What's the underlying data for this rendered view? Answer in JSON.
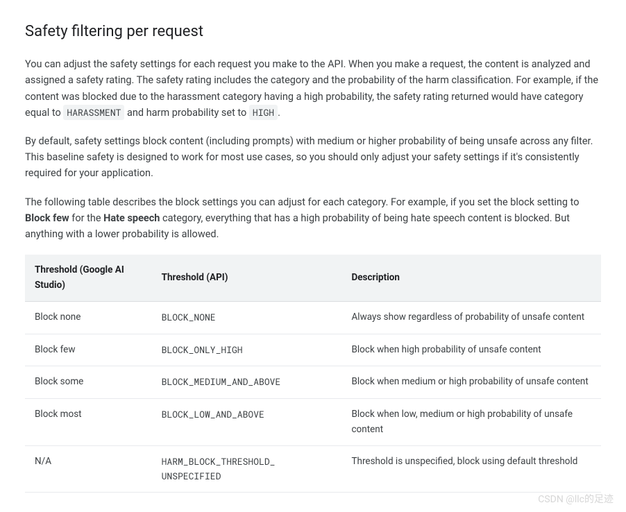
{
  "heading": "Safety filtering per request",
  "para1_pre": "You can adjust the safety settings for each request you make to the API. When you make a request, the content is analyzed and assigned a safety rating. The safety rating includes the category and the probability of the harm classification. For example, if the content was blocked due to the harassment category having a high probability, the safety rating returned would have category equal to ",
  "para1_code1": "HARASSMENT",
  "para1_mid": " and harm probability set to ",
  "para1_code2": "HIGH",
  "para1_post": ".",
  "para2": "By default, safety settings block content (including prompts) with medium or higher probability of being unsafe across any filter. This baseline safety is designed to work for most use cases, so you should only adjust your safety settings if it's consistently required for your application.",
  "para3_pre": "The following table describes the block settings you can adjust for each category. For example, if you set the block setting to ",
  "para3_bold1": "Block few",
  "para3_mid1": " for the ",
  "para3_bold2": "Hate speech",
  "para3_post": " category, everything that has a high probability of being hate speech content is blocked. But anything with a lower probability is allowed.",
  "table": {
    "headers": {
      "col_a": "Threshold (Google AI Studio)",
      "col_b": "Threshold (API)",
      "col_c": "Description"
    },
    "rows": [
      {
        "a": "Block none",
        "b": "BLOCK_NONE",
        "c": "Always show regardless of probability of unsafe content"
      },
      {
        "a": "Block few",
        "b": "BLOCK_ONLY_HIGH",
        "c": "Block when high probability of unsafe content"
      },
      {
        "a": "Block some",
        "b": "BLOCK_MEDIUM_AND_ABOVE",
        "c": "Block when medium or high probability of unsafe content"
      },
      {
        "a": "Block most",
        "b": "BLOCK_LOW_AND_ABOVE",
        "c": "Block when low, medium or high probability of unsafe content"
      },
      {
        "a": "N/A",
        "b": "HARM_BLOCK_THRESHOLD_ UNSPECIFIED",
        "c": "Threshold is unspecified, block using default threshold"
      }
    ]
  },
  "watermark": "CSDN @llc的足迹"
}
